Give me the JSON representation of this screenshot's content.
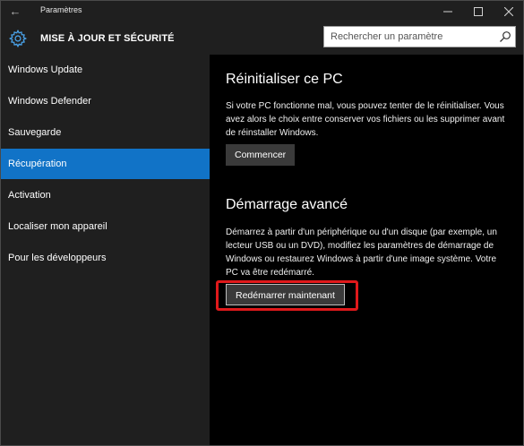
{
  "titlebar": {
    "app_title": "Paramètres",
    "back_icon": "back-arrow-icon"
  },
  "header": {
    "icon": "gear-icon",
    "title": "MISE À JOUR ET SÉCURITÉ",
    "search_placeholder": "Rechercher un paramètre"
  },
  "sidebar": {
    "items": [
      {
        "label": "Windows Update",
        "active": false
      },
      {
        "label": "Windows Defender",
        "active": false
      },
      {
        "label": "Sauvegarde",
        "active": false
      },
      {
        "label": "Récupération",
        "active": true
      },
      {
        "label": "Activation",
        "active": false
      },
      {
        "label": "Localiser mon appareil",
        "active": false
      },
      {
        "label": "Pour les développeurs",
        "active": false
      }
    ]
  },
  "reset": {
    "title": "Réinitialiser ce PC",
    "description": "Si votre PC fonctionne mal, vous pouvez tenter de le réinitialiser. Vous avez alors le choix entre conserver vos fichiers ou les supprimer avant de réinstaller Windows.",
    "button_label": "Commencer"
  },
  "advanced": {
    "title": "Démarrage avancé",
    "description": "Démarrez à partir d'un périphérique ou d'un disque (par exemple, un lecteur USB ou un DVD), modifiez les paramètres de démarrage de Windows ou restaurez Windows à partir d'une image système. Votre PC va être redémarré.",
    "button_label": "Redémarrer maintenant"
  },
  "colors": {
    "accent": "#1173c7",
    "highlight": "#e0191b",
    "sidebar_bg": "#1f1f1f",
    "content_bg": "#000000"
  }
}
